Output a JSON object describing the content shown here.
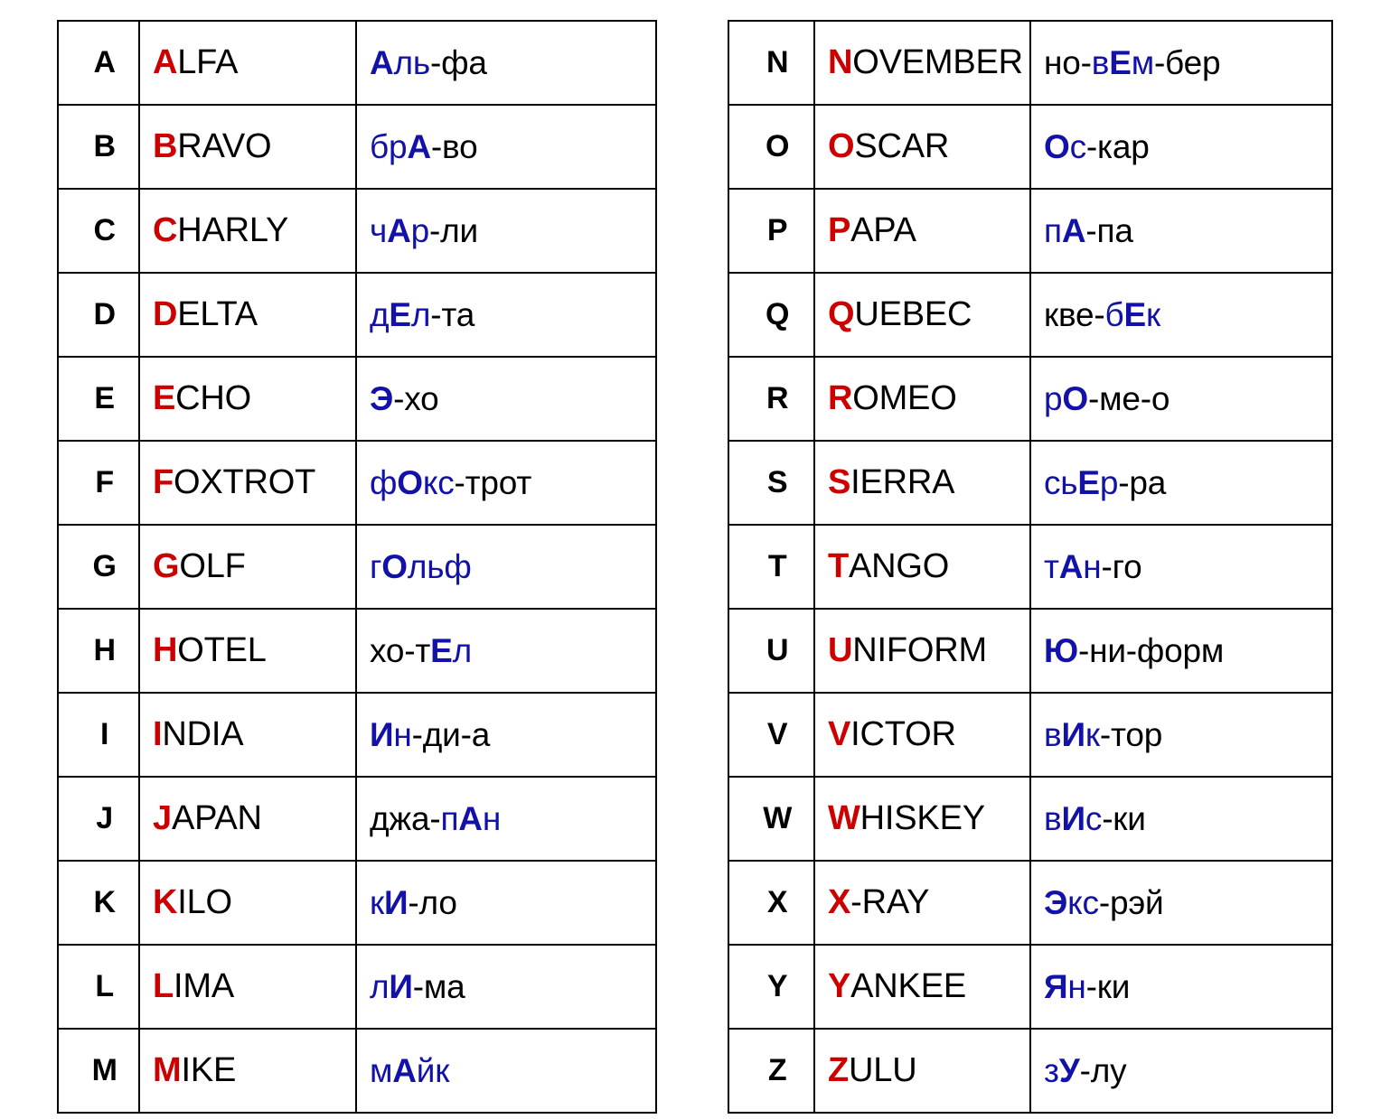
{
  "page": {
    "title": "NATO Phonetic Alphabet with Russian Pronunciation",
    "background_color": "#ffffff",
    "colors": {
      "initial_letter_red": "#CC0000",
      "stressed_syllable_blue": "#1212A8",
      "text_black": "#000000",
      "border_black": "#000000"
    }
  },
  "tables": [
    {
      "id": "left-table",
      "name": "letters-a-to-m",
      "rows": [
        {
          "letter": "A",
          "word": "ALFA",
          "word_initial": "A",
          "word_rest": "LFA",
          "pronunciation": "Аль-фа",
          "pron_pre": "",
          "pron_stress_before": "",
          "pron_stress_vowel": "А",
          "pron_stress_after": "ль",
          "pron_post": "-фа"
        },
        {
          "letter": "B",
          "word": "BRAVO",
          "word_initial": "B",
          "word_rest": "RAVO",
          "pronunciation": "брА-во",
          "pron_pre": "",
          "pron_stress_before": "бр",
          "pron_stress_vowel": "А",
          "pron_stress_after": "",
          "pron_post": "-во"
        },
        {
          "letter": "C",
          "word": "CHARLY",
          "word_initial": "C",
          "word_rest": "HARLY",
          "pronunciation": "чАр-ли",
          "pron_pre": "",
          "pron_stress_before": "ч",
          "pron_stress_vowel": "А",
          "pron_stress_after": "р",
          "pron_post": "-ли"
        },
        {
          "letter": "D",
          "word": "DELTA",
          "word_initial": "D",
          "word_rest": "ELTA",
          "pronunciation": "дЕл-та",
          "pron_pre": "",
          "pron_stress_before": "д",
          "pron_stress_vowel": "Е",
          "pron_stress_after": "л",
          "pron_post": "-та"
        },
        {
          "letter": "E",
          "word": "ECHO",
          "word_initial": "E",
          "word_rest": "CHO",
          "pronunciation": "Э-хо",
          "pron_pre": "",
          "pron_stress_before": "",
          "pron_stress_vowel": "Э",
          "pron_stress_after": "",
          "pron_post": "-хо"
        },
        {
          "letter": "F",
          "word": "FOXTROT",
          "word_initial": "F",
          "word_rest": "OXTROT",
          "pronunciation": "фОкс-трот",
          "pron_pre": "",
          "pron_stress_before": "ф",
          "pron_stress_vowel": "О",
          "pron_stress_after": "кс",
          "pron_post": "-трот"
        },
        {
          "letter": "G",
          "word": "GOLF",
          "word_initial": "G",
          "word_rest": "OLF",
          "pronunciation": "гОльф",
          "pron_pre": "",
          "pron_stress_before": "г",
          "pron_stress_vowel": "О",
          "pron_stress_after": "льф",
          "pron_post": ""
        },
        {
          "letter": "H",
          "word": "HOTEL",
          "word_initial": "H",
          "word_rest": "OTEL",
          "pronunciation": "хо-тЕл",
          "pron_pre": "хо-т",
          "pron_stress_before": "",
          "pron_stress_vowel": "Е",
          "pron_stress_after": "л",
          "pron_post": ""
        },
        {
          "letter": "I",
          "word": "INDIA",
          "word_initial": "I",
          "word_rest": "NDIA",
          "pronunciation": "Ин-ди-а",
          "pron_pre": "",
          "pron_stress_before": "",
          "pron_stress_vowel": "И",
          "pron_stress_after": "н",
          "pron_post": "-ди-а"
        },
        {
          "letter": "J",
          "word": "JAPAN",
          "word_initial": "J",
          "word_rest": "APAN",
          "pronunciation": "джа-пАн",
          "pron_pre": "джа-",
          "pron_stress_before": "п",
          "pron_stress_vowel": "А",
          "pron_stress_after": "н",
          "pron_post": ""
        },
        {
          "letter": "K",
          "word": "KILO",
          "word_initial": "K",
          "word_rest": "ILO",
          "pronunciation": "кИ-ло",
          "pron_pre": "",
          "pron_stress_before": "к",
          "pron_stress_vowel": "И",
          "pron_stress_after": "",
          "pron_post": "-ло"
        },
        {
          "letter": "L",
          "word": "LIMA",
          "word_initial": "L",
          "word_rest": "IMA",
          "pronunciation": "лИ-ма",
          "pron_pre": "",
          "pron_stress_before": "л",
          "pron_stress_vowel": "И",
          "pron_stress_after": "",
          "pron_post": "-ма"
        },
        {
          "letter": "M",
          "word": "MIKE",
          "word_initial": "M",
          "word_rest": "IKE",
          "pronunciation": "мАйк",
          "pron_pre": "",
          "pron_stress_before": "м",
          "pron_stress_vowel": "А",
          "pron_stress_after": "йк",
          "pron_post": ""
        }
      ]
    },
    {
      "id": "right-table",
      "name": "letters-n-to-z",
      "rows": [
        {
          "letter": "N",
          "word": "NOVEMBER",
          "word_initial": "N",
          "word_rest": "OVEMBER",
          "pronunciation": "но-вЕм-бер",
          "pron_pre": "но-",
          "pron_stress_before": "в",
          "pron_stress_vowel": "Е",
          "pron_stress_after": "м",
          "pron_post": "-бер"
        },
        {
          "letter": "O",
          "word": "OSCAR",
          "word_initial": "O",
          "word_rest": "SCAR",
          "pronunciation": "Ос-кар",
          "pron_pre": "",
          "pron_stress_before": "",
          "pron_stress_vowel": "О",
          "pron_stress_after": "с",
          "pron_post": "-кар"
        },
        {
          "letter": "P",
          "word": "PAPA",
          "word_initial": "P",
          "word_rest": "APA",
          "pronunciation": "пА-па",
          "pron_pre": "",
          "pron_stress_before": "п",
          "pron_stress_vowel": "А",
          "pron_stress_after": "",
          "pron_post": "-па"
        },
        {
          "letter": "Q",
          "word": "QUEBEC",
          "word_initial": "Q",
          "word_rest": "UEBEC",
          "pronunciation": "кве-бЕк",
          "pron_pre": "кве-",
          "pron_stress_before": "б",
          "pron_stress_vowel": "Е",
          "pron_stress_after": "к",
          "pron_post": ""
        },
        {
          "letter": "R",
          "word": "ROMEO",
          "word_initial": "R",
          "word_rest": "OMEO",
          "pronunciation": "рО-ме-о",
          "pron_pre": "",
          "pron_stress_before": "р",
          "pron_stress_vowel": "О",
          "pron_stress_after": "",
          "pron_post": "-ме-о"
        },
        {
          "letter": "S",
          "word": "SIERRA",
          "word_initial": "S",
          "word_rest": "IERRA",
          "pronunciation": "сьЕр-ра",
          "pron_pre": "",
          "pron_stress_before": "сь",
          "pron_stress_vowel": "Е",
          "pron_stress_after": "р",
          "pron_post": "-ра"
        },
        {
          "letter": "T",
          "word": "TANGO",
          "word_initial": "T",
          "word_rest": "ANGO",
          "pronunciation": "тАн-го",
          "pron_pre": "",
          "pron_stress_before": "т",
          "pron_stress_vowel": "А",
          "pron_stress_after": "н",
          "pron_post": "-го"
        },
        {
          "letter": "U",
          "word": "UNIFORM",
          "word_initial": "U",
          "word_rest": "NIFORM",
          "pronunciation": "Ю-ни-форм",
          "pron_pre": "",
          "pron_stress_before": "",
          "pron_stress_vowel": "Ю",
          "pron_stress_after": "",
          "pron_post": "-ни-форм"
        },
        {
          "letter": "V",
          "word": "VICTOR",
          "word_initial": "V",
          "word_rest": "ICTOR",
          "pronunciation": "вИк-тор",
          "pron_pre": "",
          "pron_stress_before": "в",
          "pron_stress_vowel": "И",
          "pron_stress_after": "к",
          "pron_post": "-тор"
        },
        {
          "letter": "W",
          "word": "WHISKEY",
          "word_initial": "W",
          "word_rest": "HISKEY",
          "pronunciation": "вИс-ки",
          "pron_pre": "",
          "pron_stress_before": "в",
          "pron_stress_vowel": "И",
          "pron_stress_after": "с",
          "pron_post": "-ки"
        },
        {
          "letter": "X",
          "word": "X-RAY",
          "word_initial": "X",
          "word_rest": "-RAY",
          "pronunciation": "Экс-рэй",
          "pron_pre": "",
          "pron_stress_before": "",
          "pron_stress_vowel": "Э",
          "pron_stress_after": "кс",
          "pron_post": "-рэй"
        },
        {
          "letter": "Y",
          "word": "YANKEE",
          "word_initial": "Y",
          "word_rest": "ANKEE",
          "pronunciation": "Ян-ки",
          "pron_pre": "",
          "pron_stress_before": "",
          "pron_stress_vowel": "Я",
          "pron_stress_after": "н",
          "pron_post": "-ки"
        },
        {
          "letter": "Z",
          "word": "ZULU",
          "word_initial": "Z",
          "word_rest": "ULU",
          "pronunciation": "зУ-лу",
          "pron_pre": "",
          "pron_stress_before": "з",
          "pron_stress_vowel": "У",
          "pron_stress_after": "",
          "pron_post": "-лу"
        }
      ]
    }
  ]
}
